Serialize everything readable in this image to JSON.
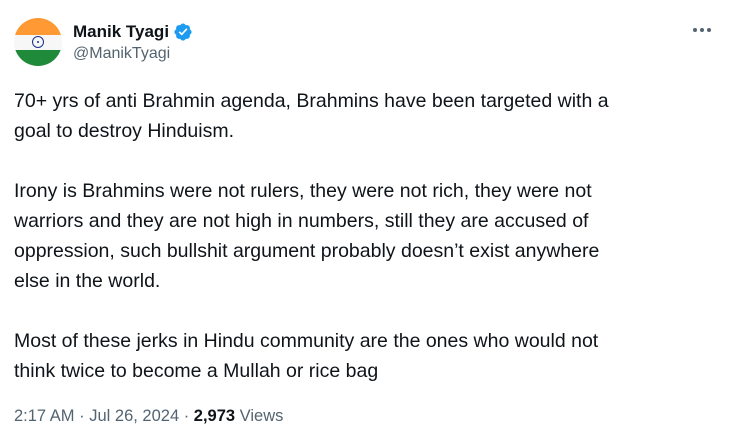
{
  "author": {
    "display_name": "Manik Tyagi",
    "handle": "@ManikTyagi",
    "verified_color": "#1d9bf0"
  },
  "avatar_flag": {
    "saffron": "#ff9933",
    "white": "#f7f7f7",
    "green": "#1f8a3a",
    "chakra": "#1c2f8c"
  },
  "tweet": {
    "paragraphs": [
      "70+ yrs of anti Brahmin agenda, Brahmins have been targeted with a\ngoal to destroy Hinduism.",
      "Irony is Brahmins were not rulers, they were not rich, they were not\nwarriors and they are not high in numbers, still they are accused of\noppression, such bullshit argument probably doesn’t exist anywhere\nelse in the world.",
      "Most of these jerks in Hindu community are the ones who would not\nthink twice to become a Mullah or rice bag"
    ]
  },
  "meta": {
    "time": "2:17 AM",
    "sep1": " · ",
    "date": "Jul 26, 2024",
    "sep2": " · ",
    "views_count": "2,973",
    "views_label": " Views"
  },
  "icons": {
    "more": "more-horizontal-icon",
    "verified": "verified-badge-icon"
  }
}
